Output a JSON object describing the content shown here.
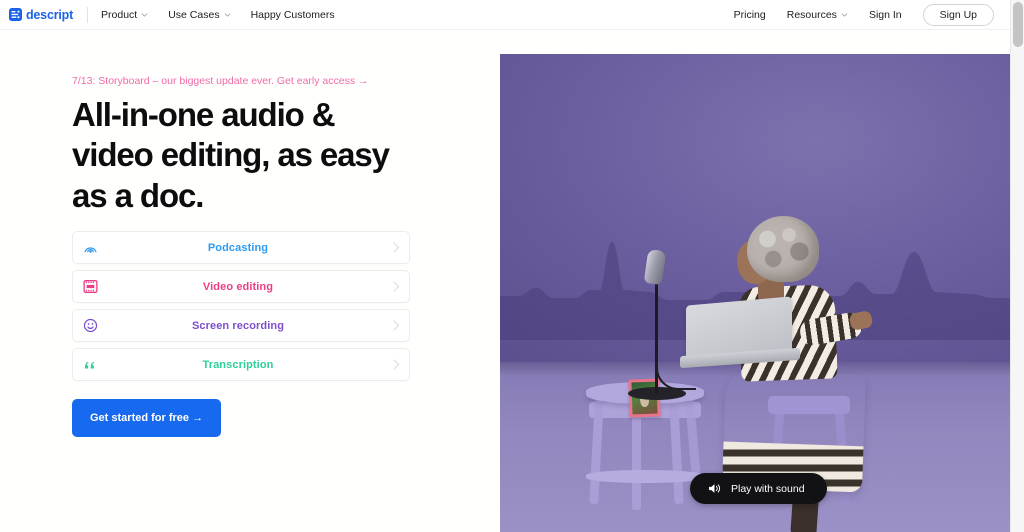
{
  "nav": {
    "logo_text": "descript",
    "left_items": [
      {
        "label": "Product",
        "has_dropdown": true
      },
      {
        "label": "Use Cases",
        "has_dropdown": true
      },
      {
        "label": "Happy Customers",
        "has_dropdown": false
      }
    ],
    "right_items": [
      {
        "label": "Pricing",
        "has_dropdown": false
      },
      {
        "label": "Resources",
        "has_dropdown": true
      },
      {
        "label": "Sign In",
        "has_dropdown": false
      }
    ],
    "signup_label": "Sign Up"
  },
  "hero": {
    "announcement": "7/13: Storyboard – our biggest update ever. Get early access →",
    "announcement_color": "#f06ba8",
    "headline": "All-in-one audio & video editing, as easy as a doc.",
    "cta_label": "Get started for free →",
    "cta_color": "#1769ef"
  },
  "cards": [
    {
      "label": "Podcasting",
      "color": "#2f9bf0",
      "icon": "broadcast-icon"
    },
    {
      "label": "Video editing",
      "color": "#ec3e84",
      "icon": "film-strip-icon"
    },
    {
      "label": "Screen recording",
      "color": "#7d4ecd",
      "icon": "smiley-face-icon"
    },
    {
      "label": "Transcription",
      "color": "#2ecf9b",
      "icon": "quote-marks-icon"
    }
  ],
  "video": {
    "play_label": "Play with sound",
    "wall_color": "#6c5fa0",
    "floor_color": "#9186bd",
    "waveform_color": "#4e4280"
  }
}
